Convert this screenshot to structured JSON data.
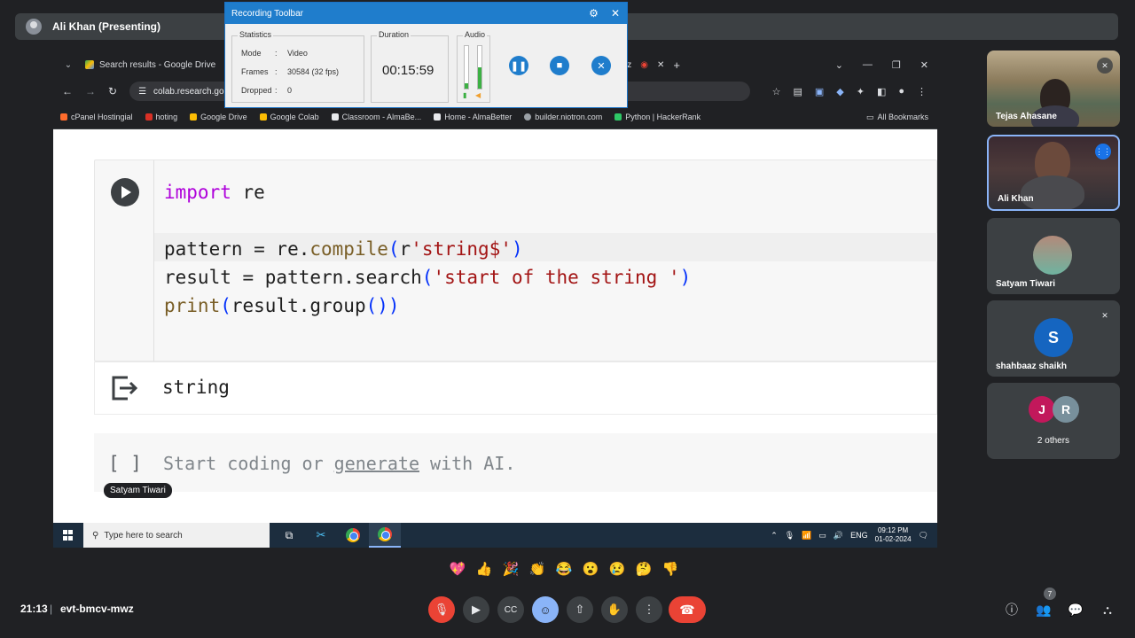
{
  "presenting": {
    "name": "Ali Khan (Presenting)"
  },
  "browser": {
    "tabs": [
      {
        "label": "Search results - Google Drive"
      }
    ],
    "tab_partial": "wz",
    "url": "colab.research.go",
    "bookmarks": [
      "cPanel Hostingial",
      "hoting",
      "Google Drive",
      "Google Colab",
      "Classroom - AlmaBe...",
      "Home - AlmaBetter",
      "builder.niotron.com",
      "Python | HackerRank"
    ],
    "all_bookmarks": "All Bookmarks"
  },
  "colab": {
    "code": {
      "line1_kw": "import",
      "line1_rest": " re",
      "line2_a": "pattern = re.",
      "line2_fn": "compile",
      "line2_open": "(",
      "line2_r": "r",
      "line2_str": "'string$'",
      "line2_close": ")",
      "line3_a": "result = pattern.search",
      "line3_open": "(",
      "line3_str": "'start of the string '",
      "line3_close": ")",
      "line4_fn": "print",
      "line4_open": "(",
      "line4_mid": "result.group",
      "line4_paren": "()",
      "line4_close": ")"
    },
    "output": "string",
    "new_cell": {
      "bracket": "[ ]",
      "prefix": "Start coding or ",
      "link": "generate",
      "suffix": " with AI."
    },
    "speaker_tag": "Satyam Tiwari"
  },
  "taskbar": {
    "search_placeholder": "Type here to search",
    "lang": "ENG",
    "time": "09:12 PM",
    "date": "01-02-2024"
  },
  "recording_toolbar": {
    "title": "Recording Toolbar",
    "statistics_label": "Statistics",
    "mode_key": "Mode",
    "mode_val": "Video",
    "frames_key": "Frames",
    "frames_val": "30584 (32 fps)",
    "dropped_key": "Dropped",
    "dropped_val": "0",
    "duration_label": "Duration",
    "duration": "00:15:59",
    "audio_label": "Audio"
  },
  "participants": [
    {
      "name": "Tejas Ahasane"
    },
    {
      "name": "Ali Khan"
    },
    {
      "name": "Satyam Tiwari"
    },
    {
      "name": "shahbaaz shaikh",
      "initial": "S"
    },
    {
      "name": "2 others",
      "initials": [
        "J",
        "R"
      ]
    }
  ],
  "reactions": [
    "💖",
    "👍",
    "🎉",
    "👏",
    "😂",
    "😮",
    "😢",
    "🤔",
    "👎"
  ],
  "meeting": {
    "time": "21:13",
    "separator": "|",
    "code": "evt-bmcv-mwz",
    "people_count": "7"
  },
  "colors": {
    "accent_blue": "#8ab4f8",
    "hangup_red": "#ea4335",
    "toolbar_blue": "#1f7dcc"
  }
}
